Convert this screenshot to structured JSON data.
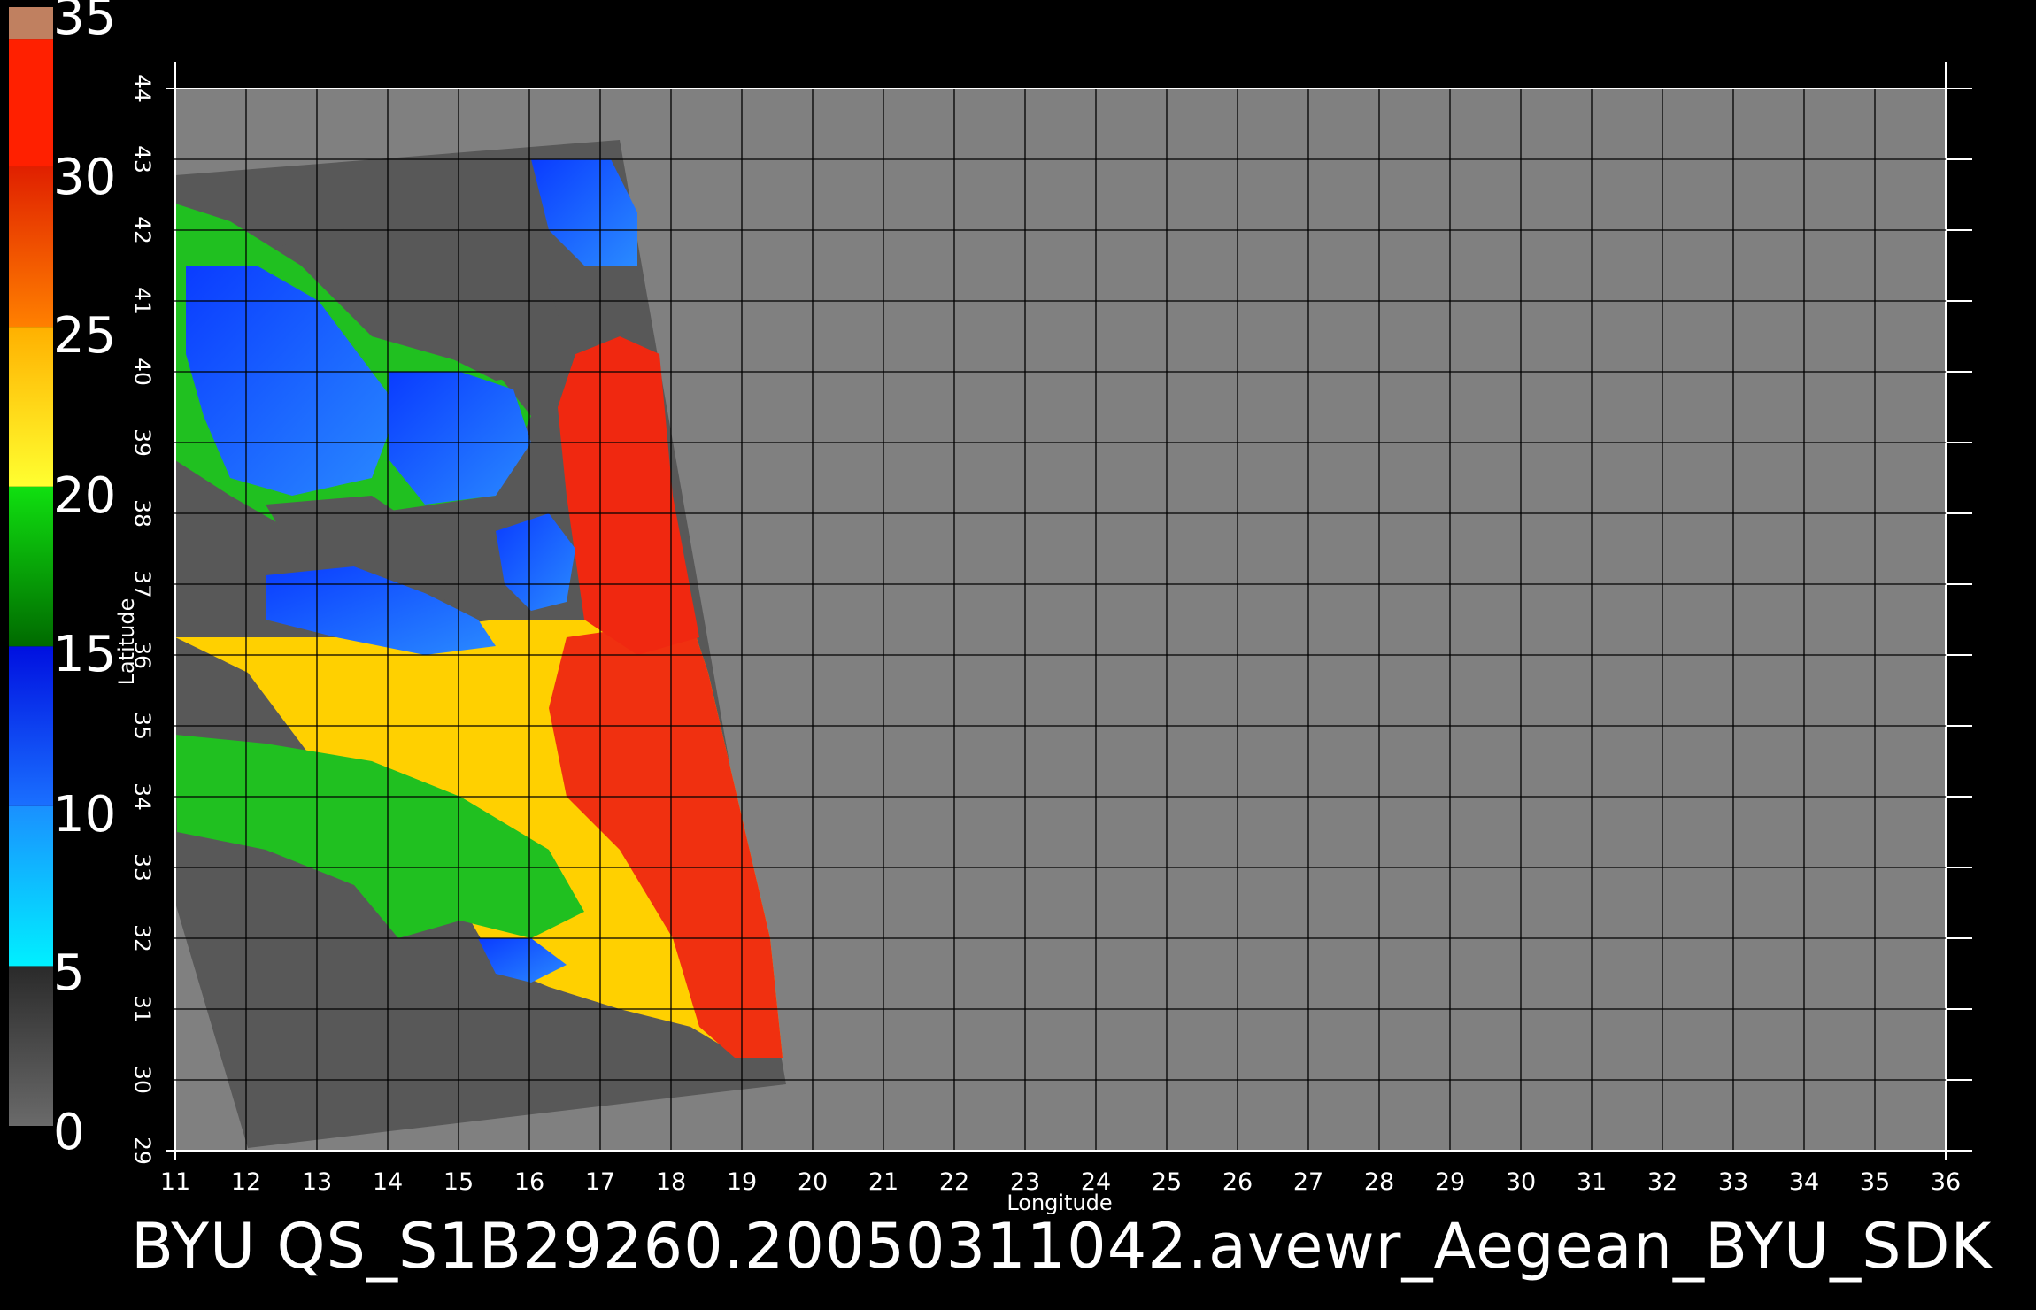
{
  "caption": "BYU  QS_S1B29260.20050311042.avewr_Aegean_BYU_SDK",
  "axes": {
    "xlabel": "Longitude",
    "ylabel": "Latitude",
    "lon_ticks": [
      "11",
      "12",
      "13",
      "14",
      "15",
      "16",
      "17",
      "18",
      "19",
      "20",
      "21",
      "22",
      "23",
      "24",
      "25",
      "26",
      "27",
      "28",
      "29",
      "30",
      "31",
      "32",
      "33",
      "34",
      "35",
      "36"
    ],
    "lat_ticks": [
      "29",
      "30",
      "31",
      "32",
      "33",
      "34",
      "35",
      "36",
      "37",
      "38",
      "39",
      "40",
      "41",
      "42",
      "43",
      "44"
    ],
    "lon_range": [
      11,
      36
    ],
    "lat_range": [
      29,
      44
    ],
    "grid": true
  },
  "colorbar": {
    "range": [
      0,
      35
    ],
    "labels": [
      "35",
      "30",
      "25",
      "20",
      "15",
      "10",
      "5",
      "0"
    ],
    "bands": [
      {
        "from": 0,
        "to": 5,
        "colors": [
          "#6a6a6a",
          "#2a2a2a"
        ]
      },
      {
        "from": 5,
        "to": 10,
        "colors": [
          "#00f0ff",
          "#1a90ff"
        ]
      },
      {
        "from": 10,
        "to": 15,
        "colors": [
          "#1a70ff",
          "#0010e0"
        ]
      },
      {
        "from": 15,
        "to": 20,
        "colors": [
          "#006a00",
          "#10e010"
        ]
      },
      {
        "from": 20,
        "to": 25,
        "colors": [
          "#ffff30",
          "#ffb000"
        ]
      },
      {
        "from": 25,
        "to": 30,
        "colors": [
          "#ff8000",
          "#e02000"
        ]
      },
      {
        "from": 30,
        "to": 34,
        "colors": [
          "#ff2000",
          "#ff2000"
        ]
      },
      {
        "from": 34,
        "to": 35,
        "colors": [
          "#c08060",
          "#c08060"
        ]
      }
    ]
  },
  "colors": {
    "background": "#000000",
    "map_fill": "#808080",
    "swath_bg": "#585858",
    "grid": "#000000"
  }
}
